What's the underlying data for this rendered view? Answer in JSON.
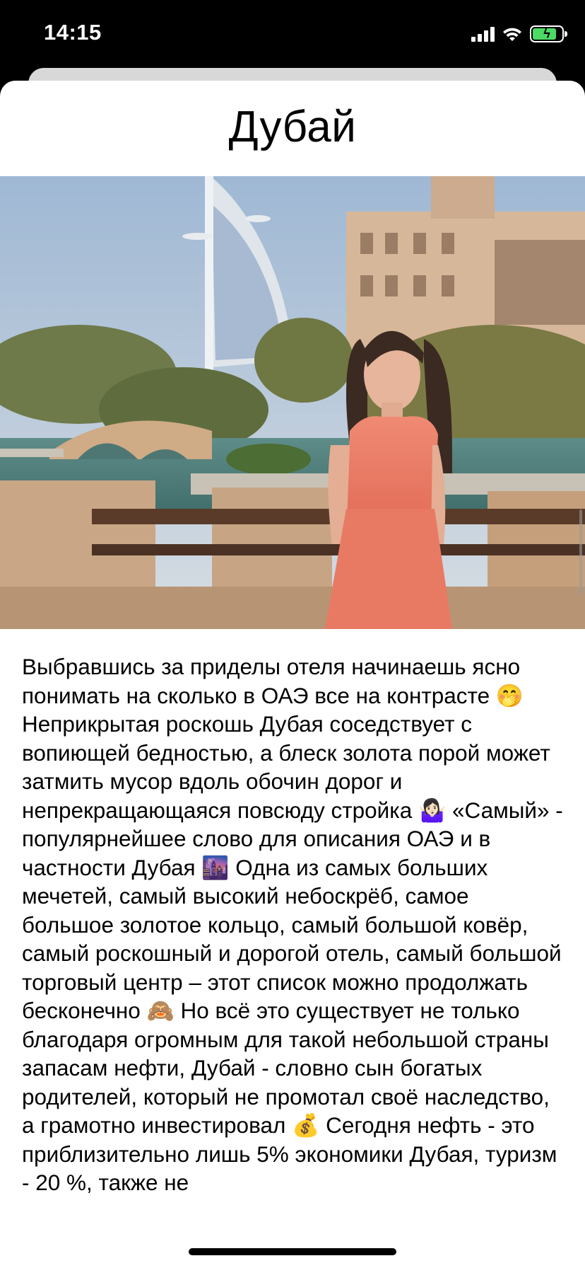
{
  "status_bar": {
    "time": "14:15",
    "icons": [
      "cellular-signal-icon",
      "wifi-icon",
      "battery-charging-icon"
    ],
    "battery_color": "#4cd964",
    "battery_level": 0.85
  },
  "post": {
    "title": "Дубай",
    "image_alt": "photo",
    "body": "Выбравшись за приделы отеля начинаешь ясно понимать на сколько в ОАЭ все на контрасте 🤭 Неприкрытая роскошь Дубая соседствует с вопиющей бедностью, а блеск золота порой может затмить мусор вдоль обочин дорог и непрекращающаяся повсюду стройка 🤷🏻‍♀️ «Самый» - популярнейшее слово для описания ОАЭ и в частности Дубая 🌆 Одна из самых больших мечетей, самый высокий небоскрёб, самое большое золотое кольцо, самый большой ковёр, самый роскошный и дорогой отель, самый большой торговый центр – этот список можно продолжать бесконечно 🙈 Но всё это существует не только благодаря огромным для такой небольшой страны запасам нефти, Дубай - словно сын богатых родителей, который не промотал своё наследство, а грамотно инвестировал 💰 Сегодня нефть - это приблизительно лишь 5% экономики Дубая, туризм - 20 %, также не"
  }
}
